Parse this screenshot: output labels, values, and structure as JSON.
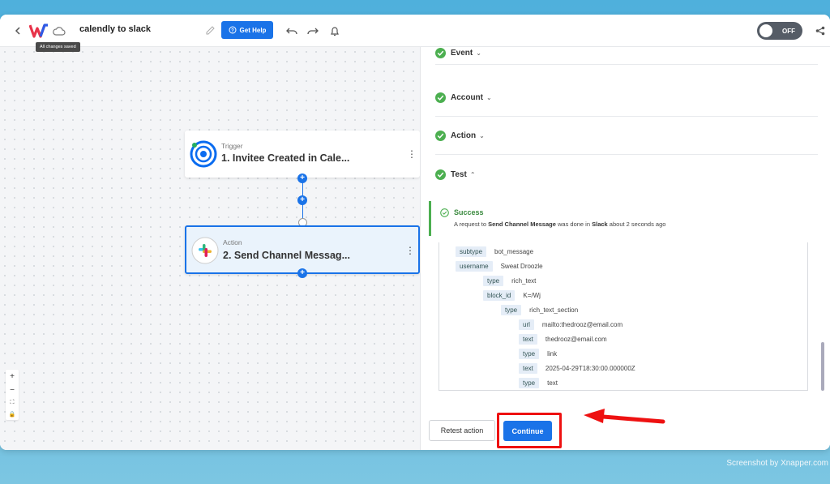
{
  "header": {
    "title": "calendly to slack",
    "tooltip": "All changes saved",
    "help_label": "Get Help",
    "toggle_label": "OFF"
  },
  "nodes": {
    "trigger": {
      "label": "Trigger",
      "name": "1. Invitee Created in Cale..."
    },
    "action": {
      "label": "Action",
      "name": "2. Send Channel Messag..."
    }
  },
  "accordion": {
    "event": "Event",
    "account": "Account",
    "action": "Action",
    "test": "Test"
  },
  "success": {
    "title": "Success",
    "msg_prefix": "A request to ",
    "msg_action": "Send Channel Message",
    "msg_mid": " was done in ",
    "msg_app": "Slack",
    "msg_suffix": " about 2 seconds ago"
  },
  "data_rows": [
    {
      "key": "subtype",
      "value": "bot_message",
      "indent": 0
    },
    {
      "key": "username",
      "value": "Sweat Droozle",
      "indent": 0
    },
    {
      "key": "type",
      "value": "rich_text",
      "indent": 1
    },
    {
      "key": "block_id",
      "value": "K=/Wj",
      "indent": 1
    },
    {
      "key": "type",
      "value": "rich_text_section",
      "indent": 2
    },
    {
      "key": "url",
      "value": "mailto:thedrooz@email.com",
      "indent": 3
    },
    {
      "key": "text",
      "value": "thedrooz@email.com",
      "indent": 3
    },
    {
      "key": "type",
      "value": "link",
      "indent": 3
    },
    {
      "key": "text",
      "value": "2025-04-29T18:30:00.000000Z",
      "indent": 3
    },
    {
      "key": "type",
      "value": "text",
      "indent": 3
    }
  ],
  "buttons": {
    "retest": "Retest action",
    "continue": "Continue"
  },
  "watermark": "Screenshot by Xnapper.com",
  "colors": {
    "accent": "#1a73e8",
    "success": "#4caf50",
    "highlight": "#e11111"
  }
}
